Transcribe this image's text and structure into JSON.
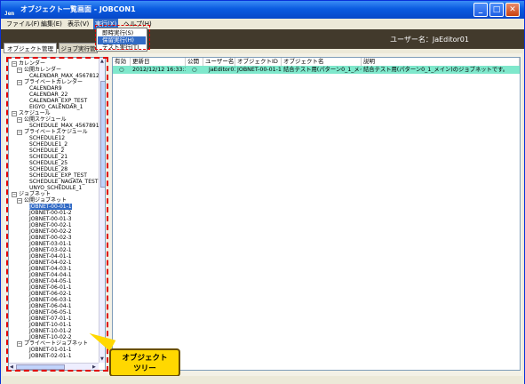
{
  "window": {
    "app_icon": "Jem",
    "title": "オブジェクト一覧画面 - JOBCON1"
  },
  "menubar": {
    "items": [
      "ファイル(F)",
      "編集(E)",
      "表示(V)",
      "実行(X)",
      "ヘルプ(H)"
    ]
  },
  "exec_menu": {
    "items": [
      "即時実行(S)",
      "保留実行(H)",
      "テスト実行(T)"
    ],
    "highlighted_index": 1
  },
  "header": {
    "user_label": "ユーザー名：JaEditor01"
  },
  "tabs": [
    "オブジェクト管理",
    "ジョブ実行管"
  ],
  "tree": {
    "nodes": [
      {
        "label": "カレンダー",
        "level": 0,
        "toggle": "⊟"
      },
      {
        "label": "公開カレンダー",
        "level": 1,
        "toggle": "⊟"
      },
      {
        "label": "CALENDAR_MAX_4567812",
        "level": 2,
        "toggle": ""
      },
      {
        "label": "プライベートカレンダー",
        "level": 1,
        "toggle": "⊟"
      },
      {
        "label": "CALENDAR9",
        "level": 2,
        "toggle": ""
      },
      {
        "label": "CALENDAR_22",
        "level": 2,
        "toggle": ""
      },
      {
        "label": "CALENDAR_EXP_TEST",
        "level": 2,
        "toggle": ""
      },
      {
        "label": "EIGYO_CALENDAR_1",
        "level": 2,
        "toggle": ""
      },
      {
        "label": "スケジュール",
        "level": 0,
        "toggle": "⊟"
      },
      {
        "label": "公開スケジュール",
        "level": 1,
        "toggle": "⊟"
      },
      {
        "label": "SCHEDULE_MAX_4567891",
        "level": 2,
        "toggle": ""
      },
      {
        "label": "プライベートスケジュール",
        "level": 1,
        "toggle": "⊟"
      },
      {
        "label": "SCHEDULE12",
        "level": 2,
        "toggle": ""
      },
      {
        "label": "SCHEDULE1_2",
        "level": 2,
        "toggle": ""
      },
      {
        "label": "SCHEDULE_2",
        "level": 2,
        "toggle": ""
      },
      {
        "label": "SCHEDULE_21",
        "level": 2,
        "toggle": ""
      },
      {
        "label": "SCHEDULE_25",
        "level": 2,
        "toggle": ""
      },
      {
        "label": "SCHEDULE_28",
        "level": 2,
        "toggle": ""
      },
      {
        "label": "SCHEDULE_EXP_TEST",
        "level": 2,
        "toggle": ""
      },
      {
        "label": "SCHEDULE_NAGATA_TEST",
        "level": 2,
        "toggle": ""
      },
      {
        "label": "UNYO_SCHEDULE_1",
        "level": 2,
        "toggle": ""
      },
      {
        "label": "ジョブネット",
        "level": 0,
        "toggle": "⊟"
      },
      {
        "label": "公開ジョブネット",
        "level": 1,
        "toggle": "⊟"
      },
      {
        "label": "JOBNET-00-01-1",
        "level": 2,
        "toggle": "",
        "selected": true
      },
      {
        "label": "JOBNET-00-01-2",
        "level": 2,
        "toggle": ""
      },
      {
        "label": "JOBNET-00-01-3",
        "level": 2,
        "toggle": ""
      },
      {
        "label": "JOBNET-00-02-1",
        "level": 2,
        "toggle": ""
      },
      {
        "label": "JOBNET-00-02-2",
        "level": 2,
        "toggle": ""
      },
      {
        "label": "JOBNET-00-02-3",
        "level": 2,
        "toggle": ""
      },
      {
        "label": "JOBNET-03-01-1",
        "level": 2,
        "toggle": ""
      },
      {
        "label": "JOBNET-03-02-1",
        "level": 2,
        "toggle": ""
      },
      {
        "label": "JOBNET-04-01-1",
        "level": 2,
        "toggle": ""
      },
      {
        "label": "JOBNET-04-02-1",
        "level": 2,
        "toggle": ""
      },
      {
        "label": "JOBNET-04-03-1",
        "level": 2,
        "toggle": ""
      },
      {
        "label": "JOBNET-04-04-1",
        "level": 2,
        "toggle": ""
      },
      {
        "label": "JOBNET-04-05-1",
        "level": 2,
        "toggle": ""
      },
      {
        "label": "JOBNET-06-01-1",
        "level": 2,
        "toggle": ""
      },
      {
        "label": "JOBNET-06-02-1",
        "level": 2,
        "toggle": ""
      },
      {
        "label": "JOBNET-06-03-1",
        "level": 2,
        "toggle": ""
      },
      {
        "label": "JOBNET-06-04-1",
        "level": 2,
        "toggle": ""
      },
      {
        "label": "JOBNET-06-05-1",
        "level": 2,
        "toggle": ""
      },
      {
        "label": "JOBNET-07-01-1",
        "level": 2,
        "toggle": ""
      },
      {
        "label": "JOBNET-10-01-1",
        "level": 2,
        "toggle": ""
      },
      {
        "label": "JOBNET-10-01-2",
        "level": 2,
        "toggle": ""
      },
      {
        "label": "JOBNET-10-02-2",
        "level": 2,
        "toggle": ""
      },
      {
        "label": "プライベートジョブネット",
        "level": 1,
        "toggle": "⊟"
      },
      {
        "label": "JOBNET-01-01-1",
        "level": 2,
        "toggle": ""
      },
      {
        "label": "JOBNET-02-01-1",
        "level": 2,
        "toggle": ""
      }
    ]
  },
  "table": {
    "columns": [
      "有効",
      "更新日",
      "公開",
      "ユーザー名",
      "オブジェクトID",
      "オブジェクト名",
      "説明"
    ],
    "rows": [
      [
        "○",
        "2012/12/12 16:33:13",
        "○",
        "JaEditor01",
        "JOBNET-00-01-1",
        "結合テスト用(パターン0_1_メイン)",
        "結合テスト用(パターン0_1_メイン)のジョブネットです。"
      ]
    ]
  },
  "callout": {
    "line1": "オブジェクト",
    "line2": "ツリー"
  },
  "colors": {
    "titlebar": "#0a5be0",
    "header": "#423a2c",
    "row_highlight": "#7fe8cc",
    "selection": "#316ac5",
    "callout": "#ffd800",
    "annotation": "#e00000"
  }
}
